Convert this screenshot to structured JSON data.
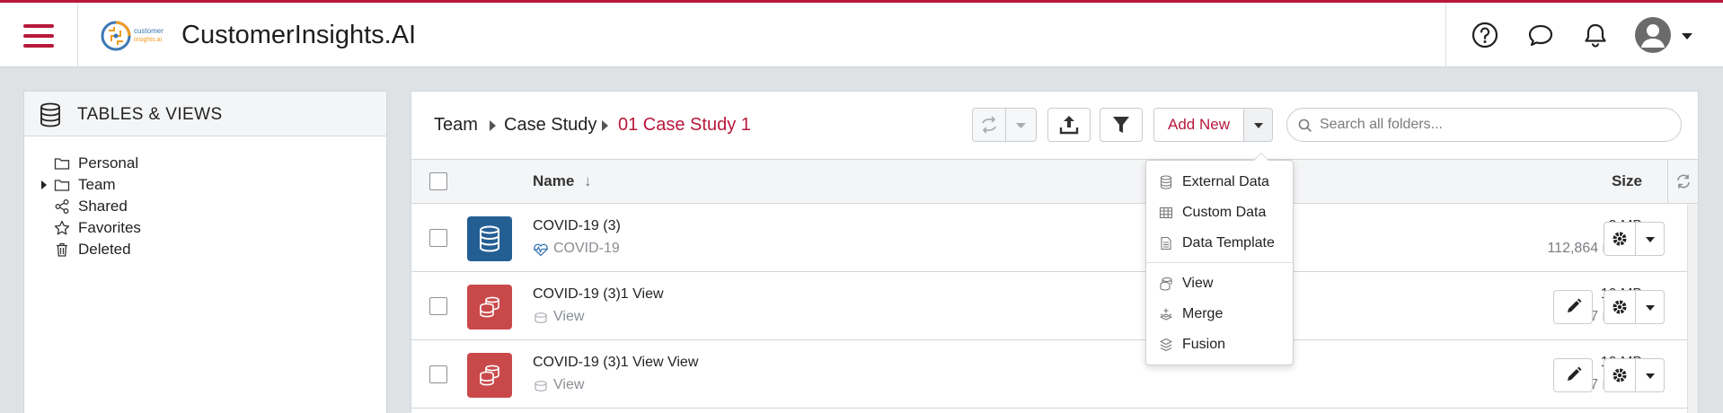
{
  "header": {
    "app_title": "CustomerInsights.AI",
    "logo_text_line1": "customer",
    "logo_text_line2": "insights.ai"
  },
  "left_panel": {
    "title": "TABLES & VIEWS",
    "items": [
      {
        "label": "Personal",
        "icon": "folder-icon"
      },
      {
        "label": "Team",
        "icon": "folder-icon",
        "expandable": true
      },
      {
        "label": "Shared",
        "icon": "share-icon"
      },
      {
        "label": "Favorites",
        "icon": "star-icon"
      },
      {
        "label": "Deleted",
        "icon": "trash-icon"
      }
    ]
  },
  "breadcrumb": [
    "Team",
    "Case Study",
    "01 Case Study 1"
  ],
  "toolbar": {
    "add_new_label": "Add New",
    "search_placeholder": "Search all folders..."
  },
  "table": {
    "columns": {
      "name": "Name",
      "sort": "↓",
      "size": "Size"
    },
    "rows": [
      {
        "name": "COVID-19 (3)",
        "sub": "COVID-19",
        "sub_icon": "heartbeat-icon",
        "size": "3 MB",
        "rows": "112,864 row(s)",
        "type": "table",
        "editable": false
      },
      {
        "name": "COVID-19 (3)1 View",
        "sub": "View",
        "sub_icon": "view-icon",
        "size": "10 MB",
        "rows": "7 row(s)",
        "type": "view",
        "editable": true
      },
      {
        "name": "COVID-19 (3)1 View View",
        "sub": "View",
        "sub_icon": "view-icon",
        "size": "10 MB",
        "rows": "7 row(s)",
        "type": "view",
        "editable": true
      }
    ]
  },
  "add_new_menu": {
    "items": [
      {
        "label": "External Data",
        "icon": "database-icon"
      },
      {
        "label": "Custom Data",
        "icon": "grid-icon"
      },
      {
        "label": "Data Template",
        "icon": "document-icon"
      },
      {
        "label": "View",
        "icon": "view-stack-icon"
      },
      {
        "label": "Merge",
        "icon": "merge-icon"
      },
      {
        "label": "Fusion",
        "icon": "layers-icon"
      }
    ]
  },
  "colors": {
    "accent": "#b8183a",
    "table_tile": "#245f94",
    "view_tile": "#c9494b"
  }
}
